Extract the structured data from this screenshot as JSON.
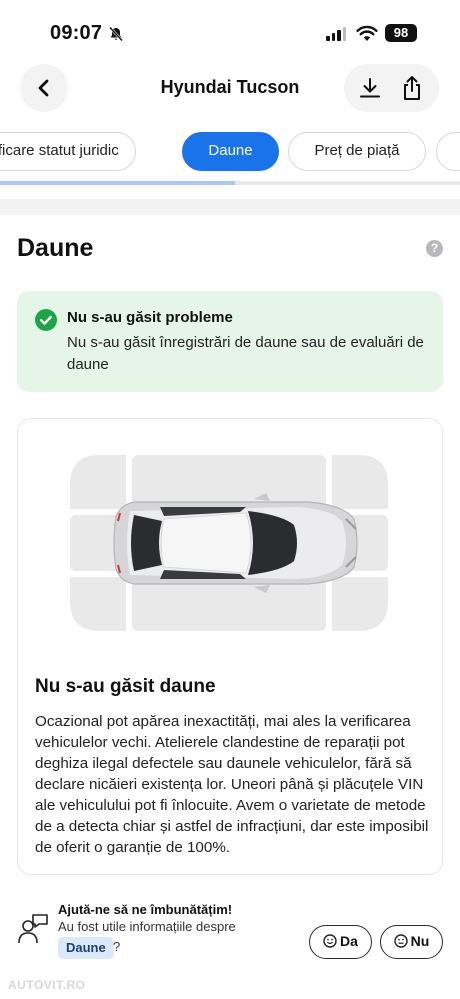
{
  "status_bar": {
    "time": "09:07",
    "battery": "98"
  },
  "header": {
    "title": "Hyundai Tucson"
  },
  "tabs": [
    {
      "label": "Verificare statut juridic",
      "active": false
    },
    {
      "label": "Daune",
      "active": true
    },
    {
      "label": "Preț de piață",
      "active": false
    }
  ],
  "tabs_scroll_progress": 0.51,
  "section": {
    "title": "Daune",
    "help": "?"
  },
  "ok_card": {
    "title": "Nu s-au găsit probleme",
    "text": "Nu s-au găsit înregistrări de daune sau de evaluări de daune"
  },
  "damage_card": {
    "title": "Nu s-au găsit daune",
    "text": "Ocazional pot apărea inexactități, mai ales la verificarea vehiculelor vechi. Atelierele clandestine de reparații pot deghiza ilegal defectele sau daunele vehiculelor, fără să declare nicăieri existența lor. Uneori până și plăcuțele VIN ale vehiculului pot fi înlocuite. Avem o varietate de metode de a detecta chiar și astfel de infracțiuni, dar este imposibil de oferit o garanție de 100%."
  },
  "feedback": {
    "title": "Ajută-ne să ne îmbunătățim!",
    "subtitle": "Au fost utile informațiile despre",
    "tag": "Daune",
    "question_mark": "?",
    "yes_label": "Da",
    "no_label": "Nu"
  },
  "watermark": "AUTOVIT.RO",
  "colors": {
    "accent": "#1a73e8",
    "success": "#1ea34a",
    "success_bg": "#e5f6e8"
  },
  "icons": [
    "back-arrow-icon",
    "download-icon",
    "share-icon",
    "check-icon",
    "help-icon",
    "feedback-icon",
    "smile-icon",
    "neutral-face-icon"
  ]
}
